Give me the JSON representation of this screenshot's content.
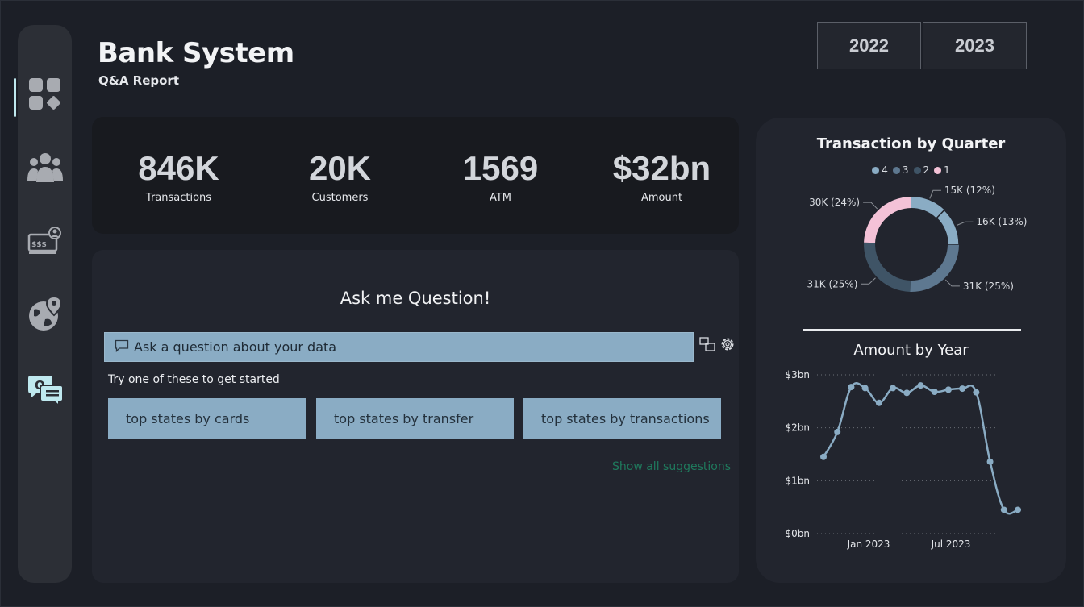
{
  "header": {
    "title": "Bank System",
    "subtitle": "Q&A Report"
  },
  "year_filters": [
    {
      "label": "2022"
    },
    {
      "label": "2023"
    }
  ],
  "sidebar": {
    "items": [
      {
        "icon": "dashboard-icon",
        "active": true
      },
      {
        "icon": "customers-icon",
        "active": false
      },
      {
        "icon": "atm-payment-icon",
        "active": false
      },
      {
        "icon": "globe-location-icon",
        "active": false
      },
      {
        "icon": "qa-chat-icon",
        "active": false
      }
    ],
    "active_color": "#bfe9ef"
  },
  "kpis": [
    {
      "value": "846K",
      "label": "Transactions"
    },
    {
      "value": "20K",
      "label": "Customers"
    },
    {
      "value": "1569",
      "label": "ATM"
    },
    {
      "value": "$32bn",
      "label": "Amount"
    }
  ],
  "qa": {
    "heading": "Ask me Question!",
    "input_placeholder": "Ask a question about your data",
    "hint": "Try one of these to get started",
    "suggestions": [
      {
        "label": "top states by cards"
      },
      {
        "label": "top states by transfer"
      },
      {
        "label": "top states by transactions"
      }
    ],
    "show_all": "Show all suggestions"
  },
  "chart_data": [
    {
      "type": "pie",
      "title": "Transaction by Quarter",
      "legend": [
        "4",
        "3",
        "2",
        "1"
      ],
      "colors": {
        "4": "#8aacc4",
        "3": "#5e7890",
        "2": "#3f5466",
        "1": "#f4c2d7"
      },
      "slices": [
        {
          "name": "4",
          "parts": [
            {
              "value": 15,
              "label": "15K (12%)"
            },
            {
              "value": 16,
              "label": "16K (13%)"
            }
          ]
        },
        {
          "name": "3",
          "value": 31,
          "label": "31K (25%)"
        },
        {
          "name": "2",
          "value": 31,
          "label": "31K (25%)"
        },
        {
          "name": "1",
          "value": 30,
          "label": "30K (24%)"
        }
      ],
      "donut": true
    },
    {
      "type": "line",
      "title": "Amount by Year",
      "x_ticks": [
        "Jan 2023",
        "Jul 2023"
      ],
      "y_ticks": [
        "$0bn",
        "$1bn",
        "$2bn",
        "$3bn"
      ],
      "ylim": [
        0,
        3
      ],
      "grid": true,
      "color": "#8aacc4",
      "series": [
        {
          "values": [
            1.45,
            1.92,
            2.77,
            2.75,
            2.47,
            2.75,
            2.66,
            2.8,
            2.68,
            2.72,
            2.74,
            2.67,
            1.36,
            0.45,
            0.45
          ]
        }
      ]
    }
  ]
}
